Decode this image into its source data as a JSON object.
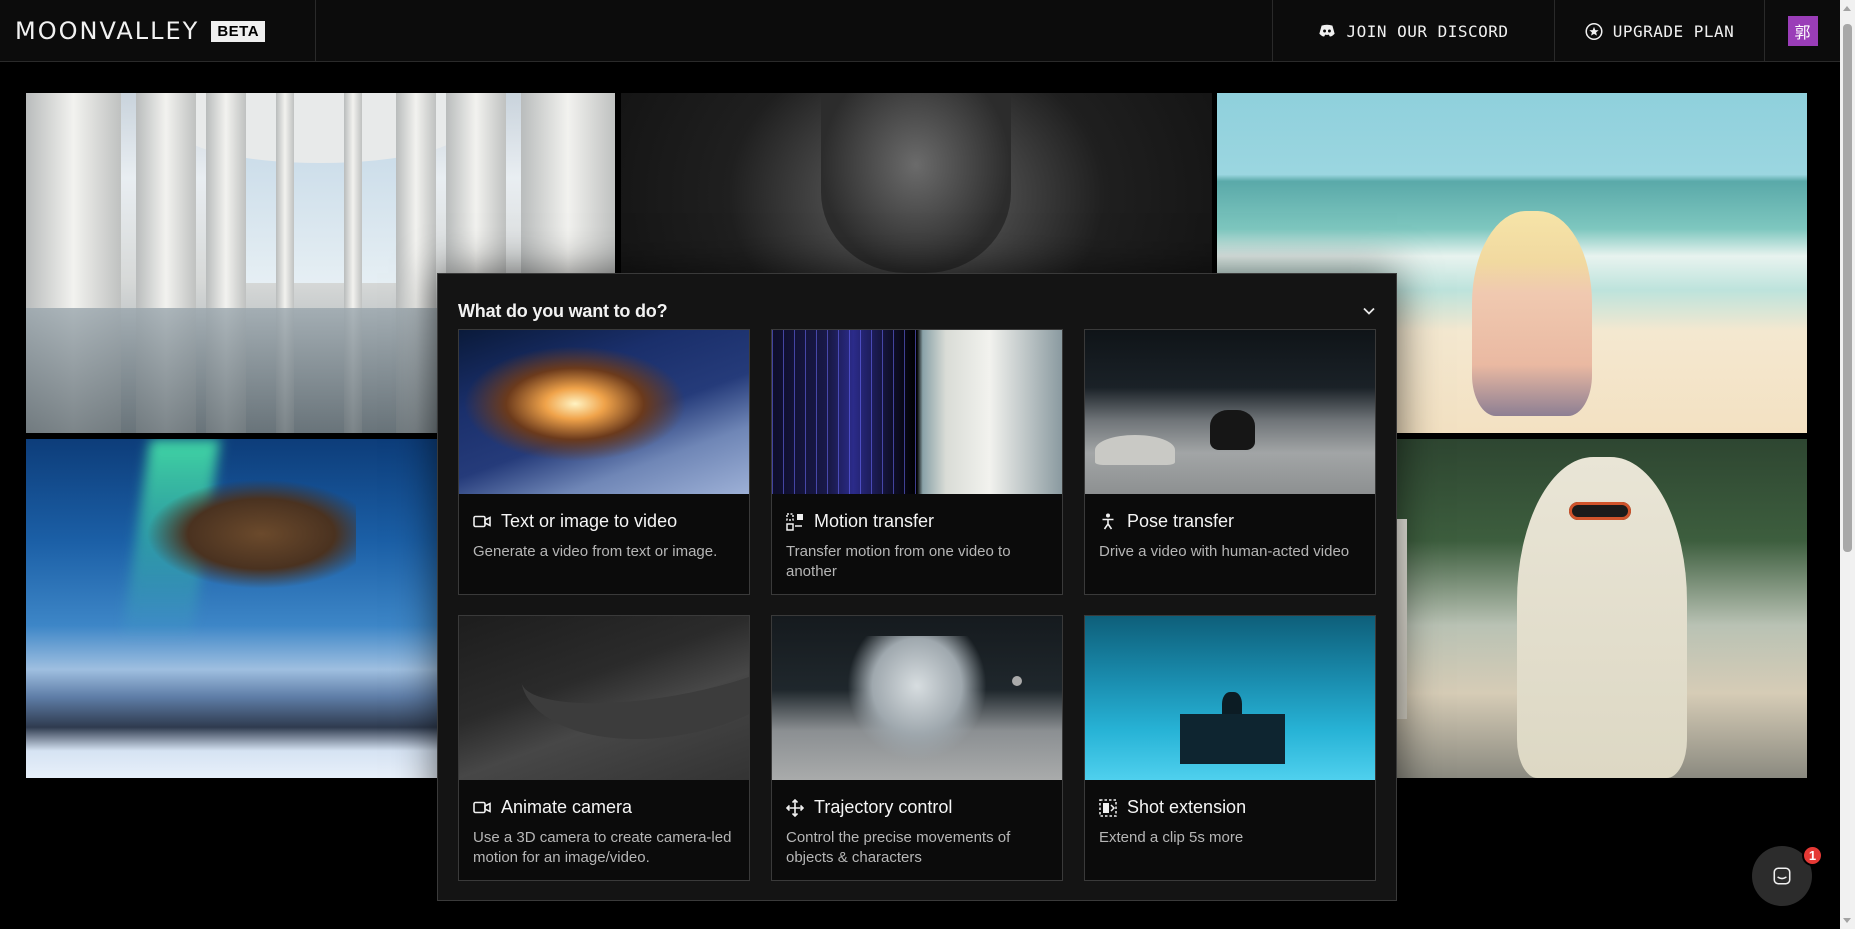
{
  "header": {
    "brand": "MOONVALLEY",
    "badge": "BETA",
    "discord_label": "JOIN OUR DISCORD",
    "upgrade_label": "UPGRADE PLAN",
    "avatar_initial": "郭",
    "avatar_color": "#9a3db8"
  },
  "gallery": {
    "tiles": [
      "columns-tile",
      "elder-portrait-tile",
      "beach-girl-tile",
      "eagle-aurora-tile",
      "robot-suburb-tile"
    ]
  },
  "modal": {
    "title": "What do you want to do?",
    "options": [
      {
        "label": "Text or image to video",
        "description": "Generate a video from text or image.",
        "icon": "video-camera-icon"
      },
      {
        "label": "Motion transfer",
        "description": "Transfer motion from one video to another",
        "icon": "motion-transfer-icon"
      },
      {
        "label": "Pose transfer",
        "description": "Drive a video with human-acted video",
        "icon": "person-pose-icon"
      },
      {
        "label": "Animate camera",
        "description": "Use a 3D camera to create camera-led motion for an image/video.",
        "icon": "video-camera-icon"
      },
      {
        "label": "Trajectory control",
        "description": "Control the precise movements of objects & characters",
        "icon": "move-arrows-icon"
      },
      {
        "label": "Shot extension",
        "description": "Extend a clip 5s more",
        "icon": "shot-extension-icon"
      }
    ]
  },
  "chat": {
    "badge_count": "1"
  }
}
